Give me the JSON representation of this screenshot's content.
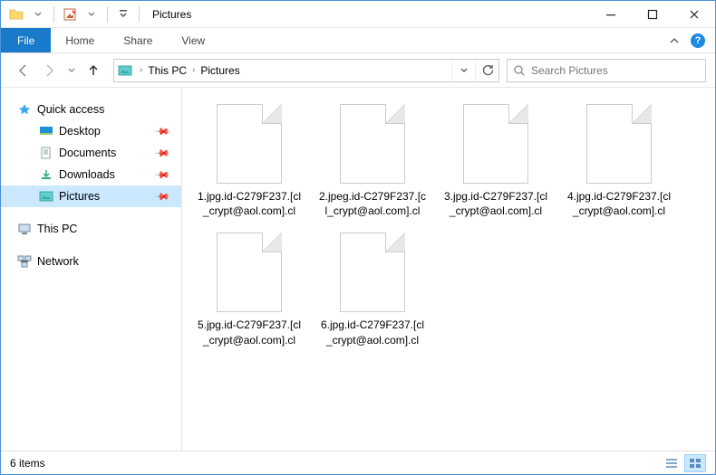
{
  "title": "Pictures",
  "ribbon": {
    "file": "File",
    "home": "Home",
    "share": "Share",
    "view": "View"
  },
  "breadcrumb": {
    "root": "This PC",
    "current": "Pictures"
  },
  "search": {
    "placeholder": "Search Pictures"
  },
  "sidebar": {
    "quick_access": "Quick access",
    "desktop": "Desktop",
    "documents": "Documents",
    "downloads": "Downloads",
    "pictures": "Pictures",
    "this_pc": "This PC",
    "network": "Network"
  },
  "files": [
    {
      "name": "1.jpg.id-C279F237.[cl_crypt@aol.com].cl"
    },
    {
      "name": "2.jpeg.id-C279F237.[cl_crypt@aol.com].cl"
    },
    {
      "name": "3.jpg.id-C279F237.[cl_crypt@aol.com].cl"
    },
    {
      "name": "4.jpg.id-C279F237.[cl_crypt@aol.com].cl"
    },
    {
      "name": "5.jpg.id-C279F237.[cl_crypt@aol.com].cl"
    },
    {
      "name": "6.jpg.id-C279F237.[cl_crypt@aol.com].cl"
    }
  ],
  "status": {
    "count": "6 items"
  }
}
